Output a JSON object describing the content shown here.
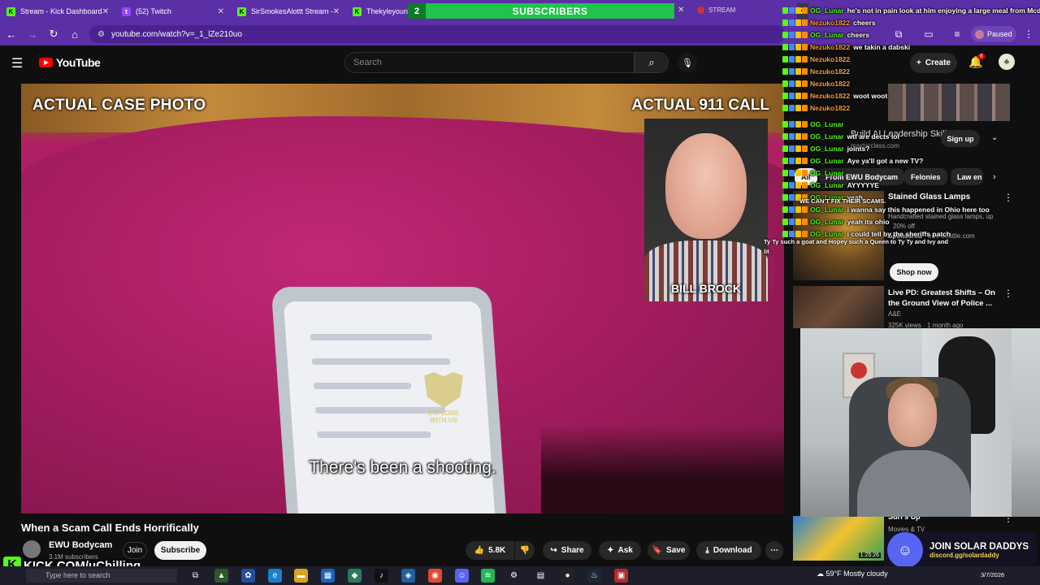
{
  "tabs": [
    {
      "title": "Stream - Kick Dashboard",
      "icon": "kick"
    },
    {
      "title": "(52) Twitch",
      "icon": "twitch"
    },
    {
      "title": "SirSmokesAlottt Stream -",
      "icon": "kick"
    },
    {
      "title": "Thekyleyoung",
      "icon": "kick"
    }
  ],
  "stream_tab": "STREAM",
  "subs_overlay": {
    "count": "2",
    "label": "SUBSCRIBERS",
    "right_count": "3"
  },
  "address": {
    "url": "youtube.com/watch?v=_1_lZe210uo"
  },
  "extension_status": "Paused",
  "youtube": {
    "logo": "YouTube",
    "search_placeholder": "Search",
    "create_label": "Create",
    "notifications": "6"
  },
  "video": {
    "caption_left": "ACTUAL CASE PHOTO",
    "caption_right": "ACTUAL 911 CALL",
    "inset_name": "BILL BROCK",
    "watermark": "EXPLORE WITH US",
    "subtitle": "There's been a shooting.",
    "title": "When a Scam Call Ends Horrifically",
    "channel": "EWU Bodycam",
    "subscribers": "3.1M subscribers",
    "join_label": "Join",
    "subscribe_label": "Subscribe",
    "likes": "5.8K",
    "share_label": "Share",
    "ask_label": "Ask",
    "save_label": "Save",
    "download_label": "Download"
  },
  "sidebar": {
    "ad": {
      "title": "Build AI Leadership Skills",
      "source": "masterclass.com",
      "cta": "Sign up"
    },
    "chips": [
      "All",
      "From EWU Bodycam",
      "Felonies",
      "Law en"
    ],
    "lamps": {
      "title": "Stained Glass Lamps",
      "desc": "Handcrafted stained glass lamps, up",
      "discount": "20% off",
      "sponsored": "Sponsored",
      "domain": "· ellie-seattle.com",
      "cta": "Shop now"
    },
    "livepd": {
      "title": "Live PD: Greatest Shifts – On the Ground View of Police ...",
      "channel": "A&E",
      "meta": "325K views · 1 month ago"
    },
    "surfs": {
      "title": "Surf's Up",
      "sub": "Movies & TV",
      "duration": "1:25:26"
    }
  },
  "chat": [
    {
      "user": "OG_Lunar",
      "msg": "he's not in pain look at him enjoying a large meal from Mcdonalds",
      "color": "#53fc18"
    },
    {
      "user": "Nezuko1822",
      "msg": "cheers",
      "color": "#ff9a3c"
    },
    {
      "user": "OG_Lunar",
      "msg": "cheers",
      "color": "#53fc18"
    },
    {
      "user": "Nezuko1822",
      "msg": "we takin a dabski",
      "color": "#ff9a3c"
    },
    {
      "user": "Nezuko1822",
      "msg": "",
      "color": "#ff9a3c"
    },
    {
      "user": "Nezuko1822",
      "msg": "",
      "color": "#ff9a3c"
    },
    {
      "user": "Nezuko1822",
      "msg": "",
      "color": "#ff9a3c"
    },
    {
      "user": "Nezuko1822",
      "msg": "woot woot",
      "color": "#ff9a3c"
    },
    {
      "user": "Nezuko1822",
      "msg": "",
      "color": "#ff9a3c"
    },
    {
      "user": "OG_Lunar",
      "msg": "",
      "color": "#53fc18"
    },
    {
      "user": "OG_Lunar",
      "msg": "wtf are dects lol",
      "color": "#53fc18"
    },
    {
      "user": "OG_Lunar",
      "msg": "joints?",
      "color": "#53fc18"
    },
    {
      "user": "OG_Lunar",
      "msg": "Aye ya'll got a new TV?",
      "color": "#53fc18"
    },
    {
      "user": "OG_Lunar",
      "msg": "",
      "color": "#53fc18"
    },
    {
      "user": "OG_Lunar",
      "msg": "AYYYYYE",
      "color": "#53fc18"
    },
    {
      "user": "OG_Lunar",
      "msg": "yeah",
      "color": "#53fc18"
    },
    {
      "user": "OG_Lunar",
      "msg": "i wanna say this happened in Ohio here too",
      "color": "#53fc18"
    },
    {
      "user": "OG_Lunar",
      "msg": "yeah its ohio",
      "color": "#53fc18"
    },
    {
      "user": "OG_Lunar",
      "msg": "i could tell by the sheriffs patch",
      "color": "#53fc18"
    }
  ],
  "chat_extras": {
    "scams": "WE CAN'T FIX THEIR SCAMS.",
    "goat": "Ty Ty such a goat and Hopey such a Queen to Ty Ty and Ivy and",
    "goat2": "lit"
  },
  "kick_overlay": {
    "k": "K",
    "text": "KICK.COM/uChilling"
  },
  "discord_overlay": {
    "title": "JOIN SOLAR DADDYS",
    "link": "discord.gg/solardaddy"
  },
  "taskbar": {
    "search_placeholder": "Type here to search",
    "weather": "59°F  Mostly cloudy",
    "date": "3/7/2026"
  }
}
